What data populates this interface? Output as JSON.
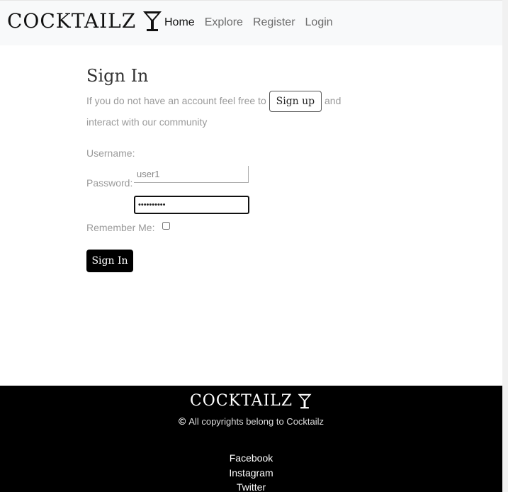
{
  "navbar": {
    "brand_text": "COCKTAILZ",
    "brand_icon": "martini-glass-icon",
    "links": [
      {
        "label": "Home",
        "active": true
      },
      {
        "label": "Explore",
        "active": false
      },
      {
        "label": "Register",
        "active": false
      },
      {
        "label": "Login",
        "active": false
      }
    ]
  },
  "main": {
    "title": "Sign In",
    "intro_before": "If you do not have an account feel free to",
    "signup_label": "Sign up",
    "intro_after": "and interact with our community"
  },
  "form": {
    "username_label": "Username:",
    "username_value": "user1",
    "password_label": "Password:",
    "password_value": "••••••••••",
    "remember_label": "Remember Me:",
    "remember_checked": false,
    "submit_label": "Sign In"
  },
  "footer": {
    "brand_text": "COCKTAILZ",
    "brand_icon": "martini-glass-icon",
    "copyright_icon": "copyright-icon",
    "copyright_text": "All copyrights belong to Cocktailz",
    "social": [
      "Facebook",
      "Instagram",
      "Twitter"
    ]
  },
  "colors": {
    "navbar_bg": "#f8f9fa",
    "footer_bg": "#000000",
    "button_bg": "#000000",
    "muted_text": "#9a9a9a"
  }
}
